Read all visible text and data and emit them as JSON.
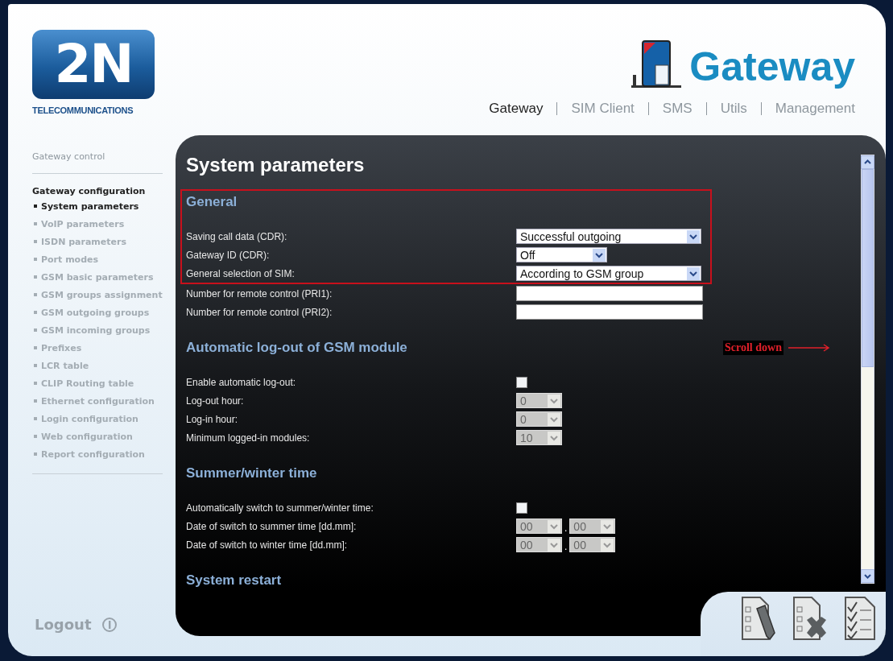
{
  "logo": {
    "mark": "2N",
    "subtitle": "TELECOMMUNICATIONS"
  },
  "product": {
    "title": "Gateway"
  },
  "nav": [
    {
      "label": "Gateway",
      "selected": true
    },
    {
      "label": "SIM Client",
      "selected": false
    },
    {
      "label": "SMS",
      "selected": false
    },
    {
      "label": "Utils",
      "selected": false
    },
    {
      "label": "Management",
      "selected": false
    }
  ],
  "sidebar": {
    "items": [
      {
        "label": "Gateway control",
        "expanded": false
      },
      {
        "label": "Gateway configuration",
        "expanded": true,
        "children": [
          {
            "label": "System parameters",
            "selected": true
          },
          {
            "label": "VoIP parameters",
            "selected": false
          },
          {
            "label": "ISDN parameters",
            "selected": false
          },
          {
            "label": "Port modes",
            "selected": false
          },
          {
            "label": "GSM basic parameters",
            "selected": false
          },
          {
            "label": "GSM groups assignment",
            "selected": false
          },
          {
            "label": "GSM outgoing groups",
            "selected": false
          },
          {
            "label": "GSM incoming groups",
            "selected": false
          },
          {
            "label": "Prefixes",
            "selected": false
          },
          {
            "label": "LCR table",
            "selected": false
          },
          {
            "label": "CLIP Routing table",
            "selected": false
          },
          {
            "label": "Ethernet configuration",
            "selected": false
          },
          {
            "label": "Login configuration",
            "selected": false
          },
          {
            "label": "Web configuration",
            "selected": false
          },
          {
            "label": "Report configuration",
            "selected": false
          }
        ]
      }
    ]
  },
  "logout": {
    "label": "Logout"
  },
  "page_title": "System parameters",
  "sections": [
    {
      "title": "General",
      "highlighted": true,
      "rows": [
        {
          "kind": "select",
          "label": "Saving call data (CDR):",
          "value": "Successful outgoing",
          "disabled": false
        },
        {
          "kind": "select",
          "label": "Gateway ID (CDR):",
          "value": "Off",
          "disabled": false
        },
        {
          "kind": "select",
          "label": "General selection of SIM:",
          "value": "According to GSM group",
          "disabled": false
        }
      ]
    },
    {
      "highlighted": false,
      "rows": [
        {
          "kind": "text",
          "label": "Number for remote control (PRI1):"
        },
        {
          "kind": "text",
          "label": "Number for remote control (PRI2):"
        }
      ]
    },
    {
      "title": "Automatic log-out of GSM module",
      "highlighted": false,
      "rows": [
        {
          "kind": "checkbox",
          "label": "Enable automatic log-out:",
          "checked": false
        },
        {
          "kind": "select",
          "label": "Log-out hour:",
          "value": "0",
          "disabled": true
        },
        {
          "kind": "select",
          "label": "Log-in hour:",
          "value": "0",
          "disabled": true
        },
        {
          "kind": "select",
          "label": "Minimum logged-in modules:",
          "value": "10",
          "disabled": true
        }
      ]
    },
    {
      "title": "Summer/winter time",
      "highlighted": false,
      "rows": [
        {
          "kind": "checkbox",
          "label": "Automatically switch to summer/winter time:",
          "checked": false
        },
        {
          "kind": "date",
          "label": "Date of switch to summer time [dd.mm]:",
          "values": [
            "00",
            "00"
          ],
          "separator": ".",
          "disabled": true
        },
        {
          "kind": "date",
          "label": "Date of switch to winter time [dd.mm]:",
          "values": [
            "00",
            "00"
          ],
          "separator": ".",
          "disabled": true
        }
      ]
    },
    {
      "title": "System restart",
      "highlighted": false
    }
  ],
  "annotation": {
    "text": "Scroll down"
  }
}
